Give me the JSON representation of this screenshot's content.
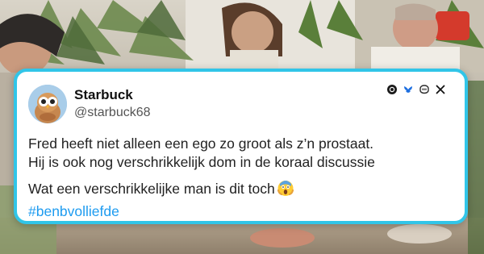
{
  "tweet": {
    "display_name": "Starbuck",
    "handle": "@starbuck68",
    "lines": [
      "Fred heeft niet alleen een ego zo groot als z’n prostaat.",
      "Hij is ook nog verschrikkelijk dom in de koraal discussie",
      "Wat een verschrikkelijke man is dit toch"
    ],
    "emoji": "😱",
    "hashtag": "#benbvolliefde"
  },
  "social_icons": [
    "threads-icon",
    "bluesky-icon",
    "mastodon-icon",
    "x-icon"
  ],
  "colors": {
    "card_border": "#31c5e8",
    "hashtag": "#1d9bf0",
    "text": "#222222"
  }
}
